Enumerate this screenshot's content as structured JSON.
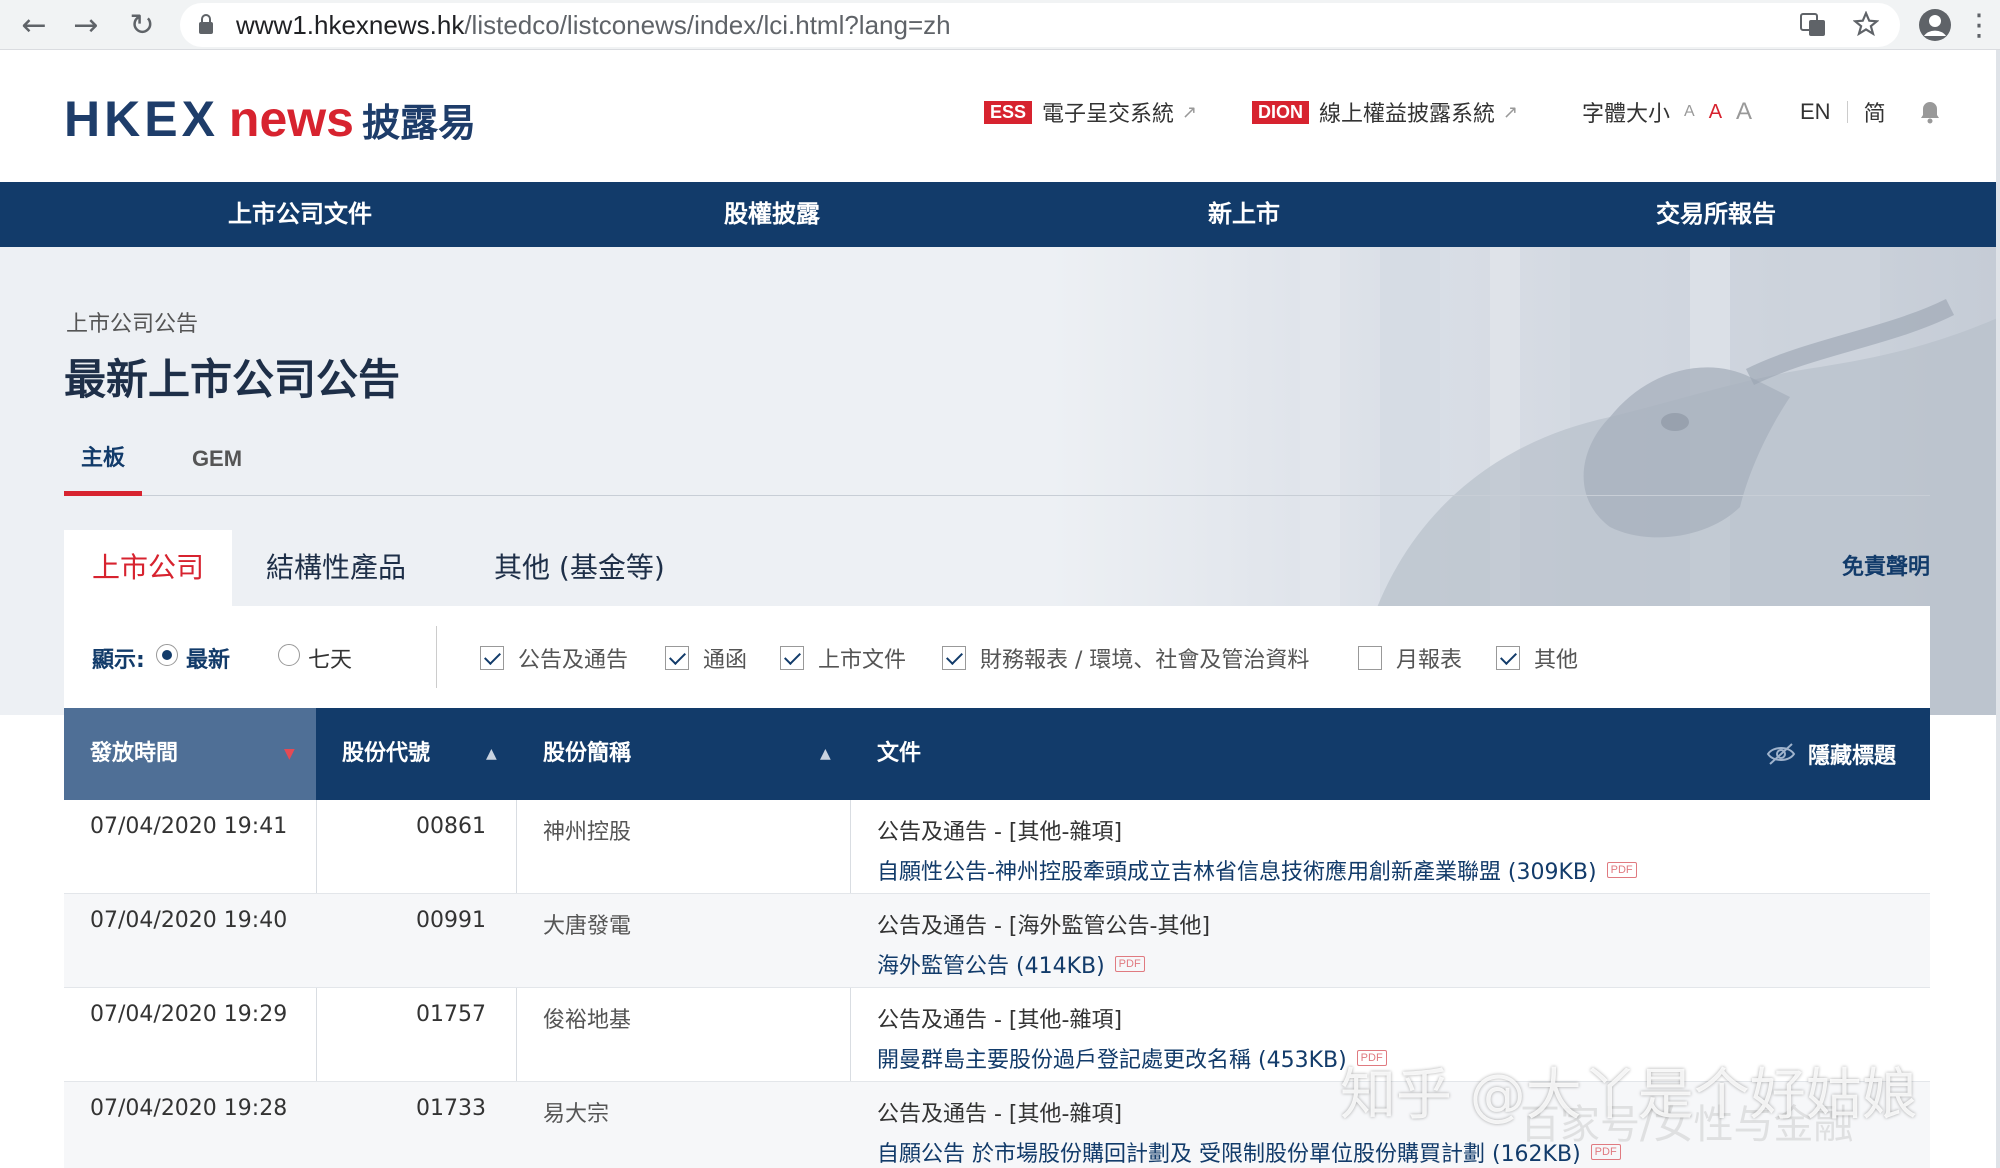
{
  "browser": {
    "url_host": "www1.hkexnews.hk",
    "url_path": "/listedco/listconews/index/lci.html?lang=zh"
  },
  "header": {
    "logo_hkex": "HKEX",
    "logo_news": "news",
    "logo_zh": "披露易",
    "ess_tag": "ESS",
    "ess_label": "電子呈交系統",
    "dion_tag": "DION",
    "dion_label": "線上權益披露系統",
    "font_size_label": "字體大小",
    "font_a": "A",
    "lang_en": "EN",
    "lang_sc": "简"
  },
  "nav": {
    "items": [
      "上市公司文件",
      "股權披露",
      "新上市",
      "交易所報告"
    ]
  },
  "breadcrumb": "上市公司公告",
  "page_title": "最新上市公司公告",
  "board_tabs": [
    "主板",
    "GEM"
  ],
  "category_tabs": [
    "上市公司",
    "結構性產品",
    "其他 (基金等)"
  ],
  "disclaimer": "免責聲明",
  "filter": {
    "show_label": "顯示:",
    "radio_latest": "最新",
    "radio_7days": "七天",
    "checkboxes": [
      {
        "label": "公告及通告",
        "checked": true
      },
      {
        "label": "通函",
        "checked": true
      },
      {
        "label": "上市文件",
        "checked": true
      },
      {
        "label": "財務報表 / 環境、社會及管治資料",
        "checked": true
      },
      {
        "label": "月報表",
        "checked": false
      },
      {
        "label": "其他",
        "checked": true
      }
    ]
  },
  "table": {
    "headers": {
      "time": "發放時間",
      "code": "股份代號",
      "name": "股份簡稱",
      "doc": "文件",
      "hide": "隱藏標題"
    },
    "rows": [
      {
        "time": "07/04/2020 19:41",
        "code": "00861",
        "name": "神州控股",
        "doc_type": "公告及通告 - [其他-雜項]",
        "doc_title": "自願性公告-神州控股牽頭成立吉林省信息技術應用創新產業聯盟 (309KB)"
      },
      {
        "time": "07/04/2020 19:40",
        "code": "00991",
        "name": "大唐發電",
        "doc_type": "公告及通告 - [海外監管公告-其他]",
        "doc_title": "海外監管公告 (414KB)"
      },
      {
        "time": "07/04/2020 19:29",
        "code": "01757",
        "name": "俊裕地基",
        "doc_type": "公告及通告 - [其他-雜項]",
        "doc_title": "開曼群島主要股份過戶登記處更改名稱 (453KB)"
      },
      {
        "time": "07/04/2020 19:28",
        "code": "01733",
        "name": "易大宗",
        "doc_type": "公告及通告 - [其他-雜項]",
        "doc_title": "自願公告 於市場股份購回計劃及 受限制股份單位股份購買計劃 (162KB)"
      }
    ],
    "pdf_label": "PDF"
  },
  "watermark": "知乎 @大丫是个好姑娘",
  "watermark2": "百家号/女性与金融"
}
